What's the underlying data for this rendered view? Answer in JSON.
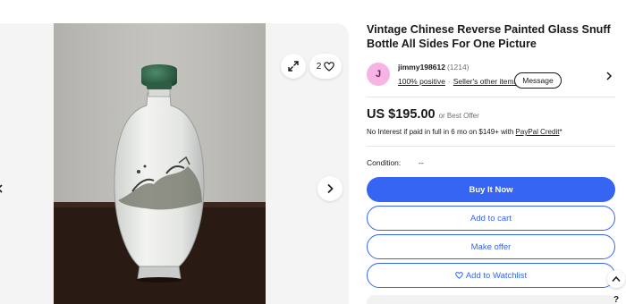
{
  "listing": {
    "title": "Vintage Chinese Reverse Painted Glass Snuff Bottle All Sides For One Picture"
  },
  "gallery": {
    "watch_count": "2",
    "expand_icon": "expand-arrows-icon",
    "heart_icon": "heart-icon",
    "next_icon": "chevron-right-icon"
  },
  "seller": {
    "avatar_letter": "J",
    "avatar_color": "#f5b4e4",
    "name": "jimmy198612",
    "feedback_count": "(1214)",
    "positive": "100% positive",
    "other_items": "Seller's other items",
    "message_label": "Message"
  },
  "pricing": {
    "price": "US $195.00",
    "best_offer": "or Best Offer",
    "credit_text": "No Interest if paid in full in 6 mo on $149+ with ",
    "credit_link": "PayPal Credit",
    "credit_suffix": "*"
  },
  "condition": {
    "label": "Condition:",
    "value": "--"
  },
  "actions": {
    "buy_now": "Buy It Now",
    "add_to_cart": "Add to cart",
    "make_offer": "Make offer",
    "add_to_watchlist": "Add to Watchlist"
  },
  "misc": {
    "help": "?"
  },
  "colors": {
    "primary_blue": "#3665f3",
    "text": "#191919",
    "muted": "#707070"
  }
}
